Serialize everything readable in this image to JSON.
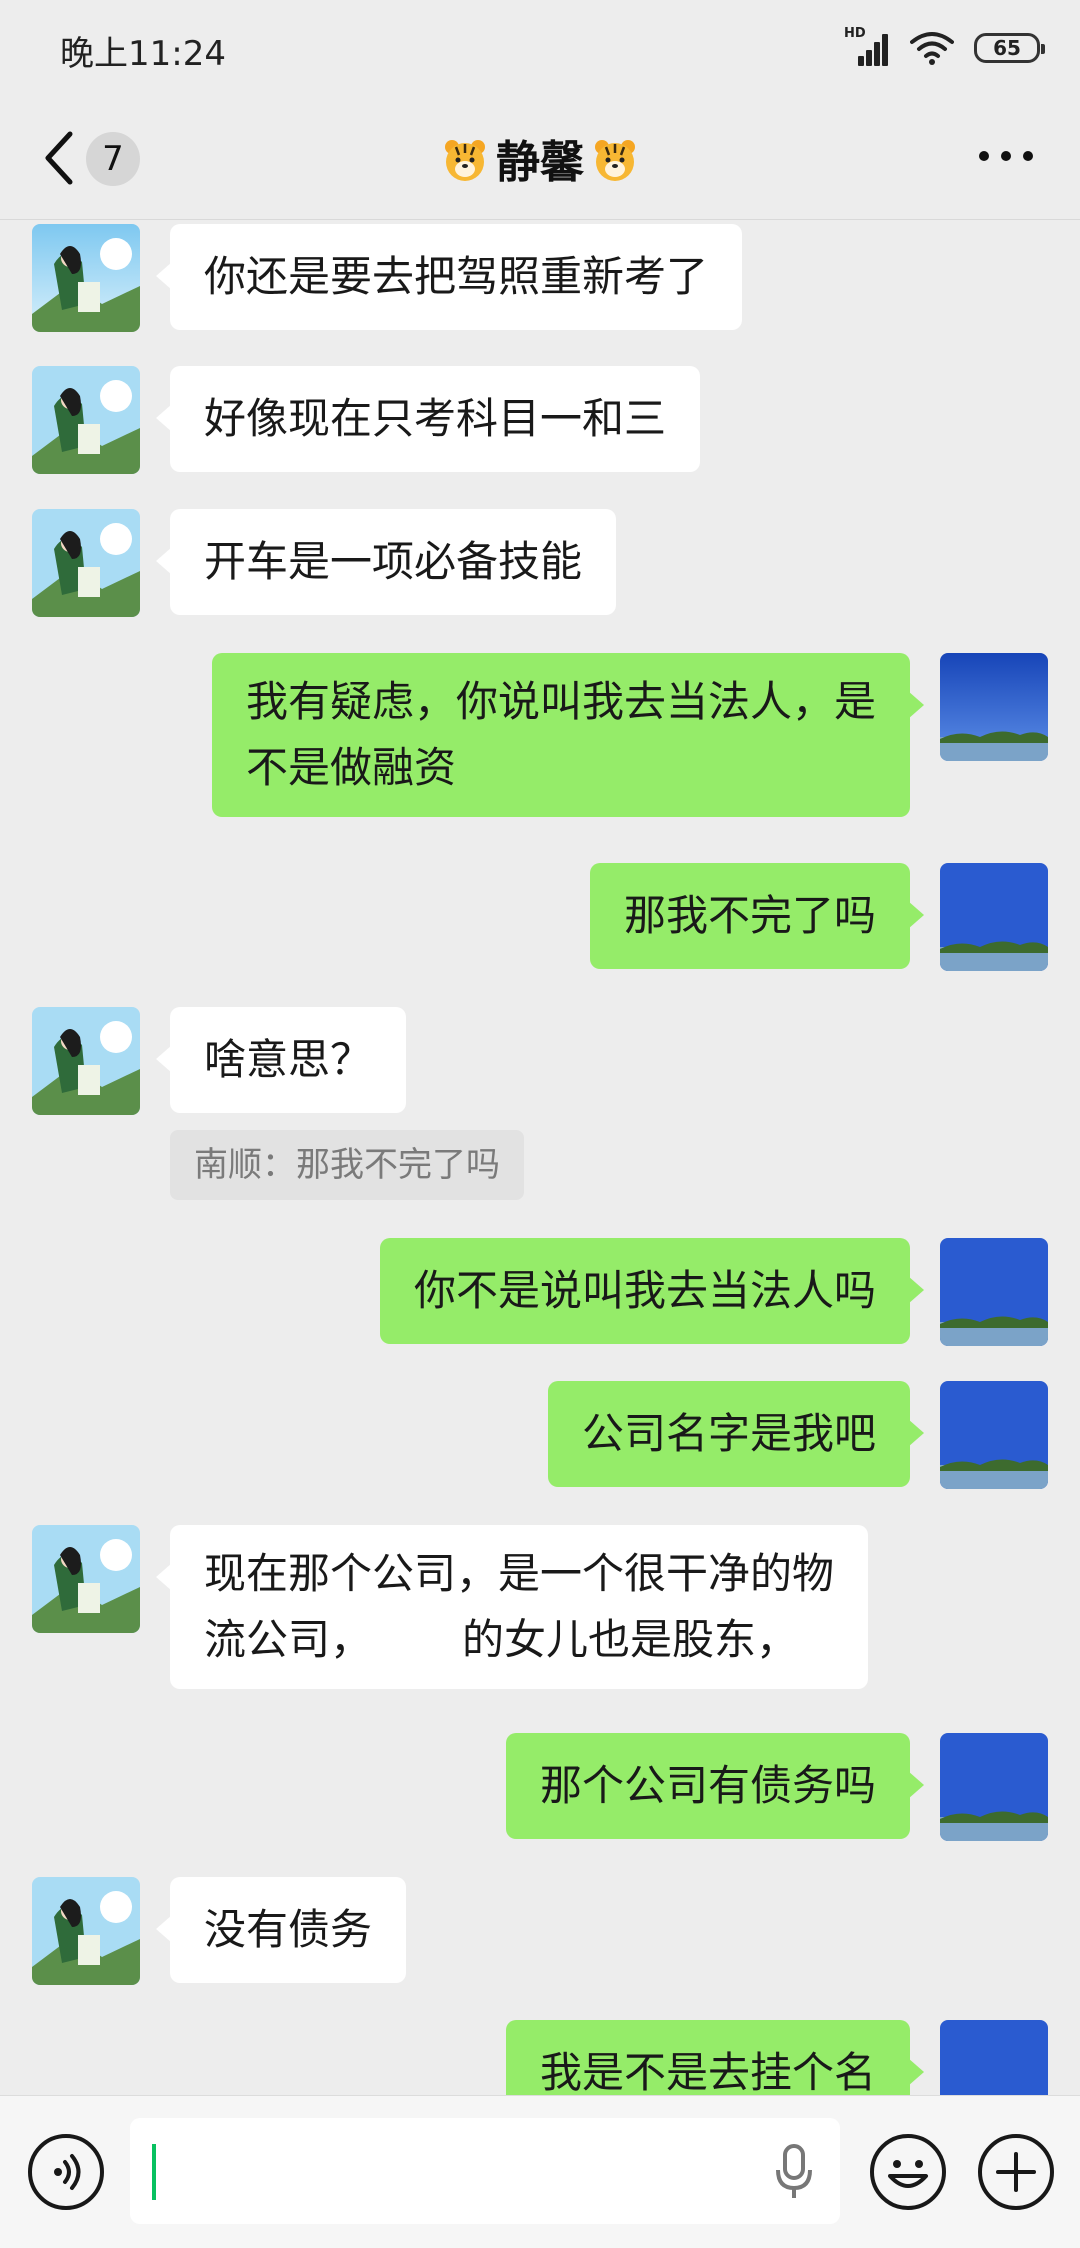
{
  "status_bar": {
    "time": "晚上11:24",
    "network": "HD",
    "battery": "65"
  },
  "header": {
    "unread_count": "7",
    "contact_name": "静馨",
    "title_icon": "tiger-face-emoji"
  },
  "messages": [
    {
      "side": "left",
      "text": "你还是要去把驾照重新考了"
    },
    {
      "side": "left",
      "text": "好像现在只考科目一和三"
    },
    {
      "side": "left",
      "text": "开车是一项必备技能"
    },
    {
      "side": "right",
      "lines": [
        "我有疑虑，你说叫我去当法人，是",
        "不是做融资"
      ]
    },
    {
      "side": "right",
      "text": "那我不完了吗"
    },
    {
      "side": "left",
      "text": "啥意思？"
    },
    {
      "side": "quote",
      "text": "南顺：那我不完了吗"
    },
    {
      "side": "right",
      "text": "你不是说叫我去当法人吗"
    },
    {
      "side": "right",
      "text": "公司名字是我吧"
    },
    {
      "side": "left",
      "lines": [
        "现在那个公司，是一个很干净的物",
        "流公司，",
        "的女儿也是股东，"
      ]
    },
    {
      "side": "right",
      "text": "那个公司有债务吗"
    },
    {
      "side": "left",
      "text": "没有债务"
    },
    {
      "side": "right",
      "text": "我是不是去挂个名"
    }
  ],
  "colors": {
    "background": "#ededed",
    "sent_bubble": "#95ec69",
    "received_bubble": "#ffffff",
    "cursor": "#07c160"
  }
}
